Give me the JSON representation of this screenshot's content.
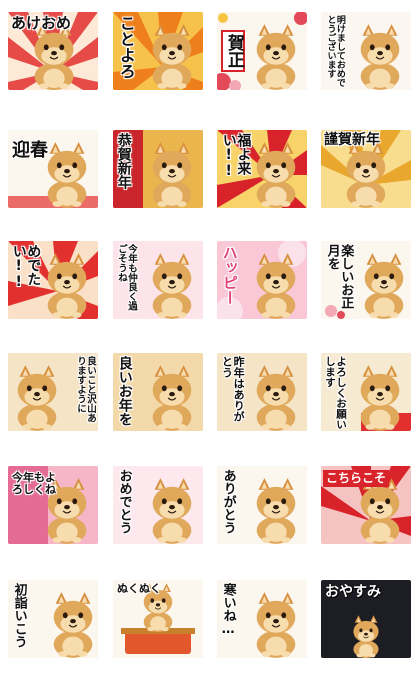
{
  "stickers": [
    {
      "text": "あけおめ",
      "bg": "burst_red"
    },
    {
      "text": "ことよろ",
      "bg": "burst_orange"
    },
    {
      "text": "賀正",
      "bg": "white_flowers"
    },
    {
      "text": "明けましておめでとうございます",
      "bg": "white_plain"
    },
    {
      "text": "迎春",
      "bg": "white_plain"
    },
    {
      "text": "恭賀新年",
      "bg": "red_gold"
    },
    {
      "text": "福よ来い!!",
      "bg": "burst_red"
    },
    {
      "text": "謹賀新年",
      "bg": "burst_gold"
    },
    {
      "text": "めでたい!!",
      "bg": "burst_red"
    },
    {
      "text": "今年も仲良く過ごそうね",
      "bg": "pink"
    },
    {
      "text": "ハッピー",
      "bg": "pink"
    },
    {
      "text": "楽しいお正月を",
      "bg": "white_plain"
    },
    {
      "text": "良いこと沢山ありますように",
      "bg": "warm"
    },
    {
      "text": "良いお年を",
      "bg": "warm"
    },
    {
      "text": "昨年はありがとう",
      "bg": "warm"
    },
    {
      "text": "よろしくお願いします",
      "bg": "cream"
    },
    {
      "text": "今年もよろしくね",
      "bg": "pink"
    },
    {
      "text": "おめでとう",
      "bg": "pink_light"
    },
    {
      "text": "ありがとう",
      "bg": "white_plain"
    },
    {
      "text": "こちらこそ",
      "bg": "burst_red"
    },
    {
      "text": "初詣いこう",
      "bg": "white_plain"
    },
    {
      "text": "ぬくぬく",
      "bg": "white_plain"
    },
    {
      "text": "寒いね…",
      "bg": "white_plain"
    },
    {
      "text": "おやすみ",
      "bg": "dark"
    }
  ],
  "colors": {
    "red": "#d8232a",
    "orange": "#f28a1e",
    "gold": "#e6b34a",
    "pink": "#f6b6c8",
    "cream": "#f7ead2",
    "dog_fur": "#e0a85a",
    "dog_cream": "#f7dcae",
    "dark": "#1d1d24"
  },
  "icons": [
    "shiba-dog"
  ]
}
